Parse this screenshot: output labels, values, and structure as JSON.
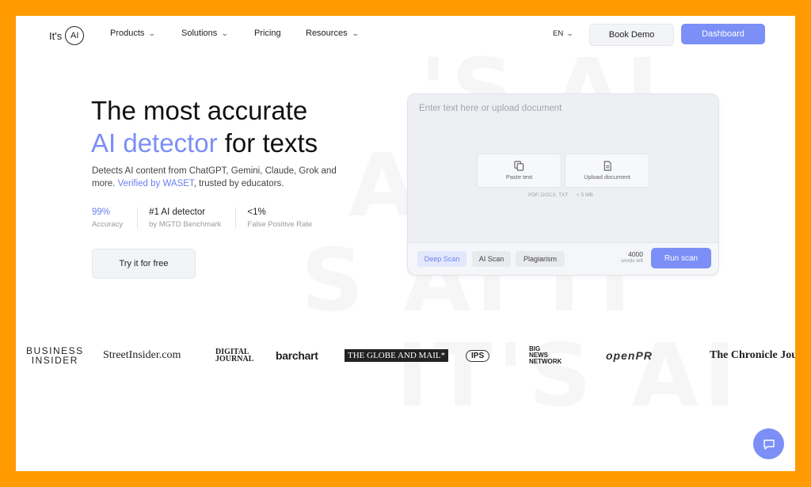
{
  "brand": {
    "logo_text": "It's",
    "logo_mark": "AI"
  },
  "nav": {
    "items": [
      {
        "label": "Products"
      },
      {
        "label": "Solutions"
      },
      {
        "label": "Pricing"
      },
      {
        "label": "Resources"
      }
    ],
    "language": "EN",
    "book_demo": "Book Demo",
    "dashboard": "Dashboard"
  },
  "hero": {
    "title_line1": "The most accurate",
    "title_accent": "AI detector",
    "title_rest": " for texts",
    "desc_part1": "Detects AI content from ChatGPT, Gemini, Claude, Grok and more. ",
    "desc_link": "Verified by WASET",
    "desc_part2": ", trusted by educators.",
    "stats": [
      {
        "value": "99%",
        "label": "Accuracy"
      },
      {
        "value": "#1 AI detector",
        "label": "by MGTD Benchmark"
      },
      {
        "value": "<1%",
        "label": "False Positive Rate"
      }
    ],
    "cta": "Try it for free"
  },
  "scanner": {
    "placeholder": "Enter text here or upload document",
    "paste_label": "Paste text",
    "upload_label": "Upload document",
    "formats": "PDF, DOCX, TXT",
    "size_limit": "< 5 MB",
    "modes": [
      "Deep Scan",
      "AI Scan",
      "Plagiarism"
    ],
    "words_count": "4000",
    "words_label": "words left",
    "run_label": "Run scan"
  },
  "press": {
    "business_insider_1": "BUSINESS",
    "business_insider_2": "INSIDER",
    "streetinsider": "StreetInsider.com",
    "digital_1": "DIGITAL",
    "digital_2": "JOURNAL",
    "barchart": "barchart",
    "globe": "THE GLOBE AND MAIL*",
    "ips": "IPS",
    "bnn_1": "BIG",
    "bnn_2": "NEWS",
    "bnn_3": "NETWORK",
    "openpr": "openPR",
    "chronicle": "The Chronicle Journ"
  },
  "colors": {
    "accent": "#7b8ff7",
    "frame": "#FF9A00"
  }
}
